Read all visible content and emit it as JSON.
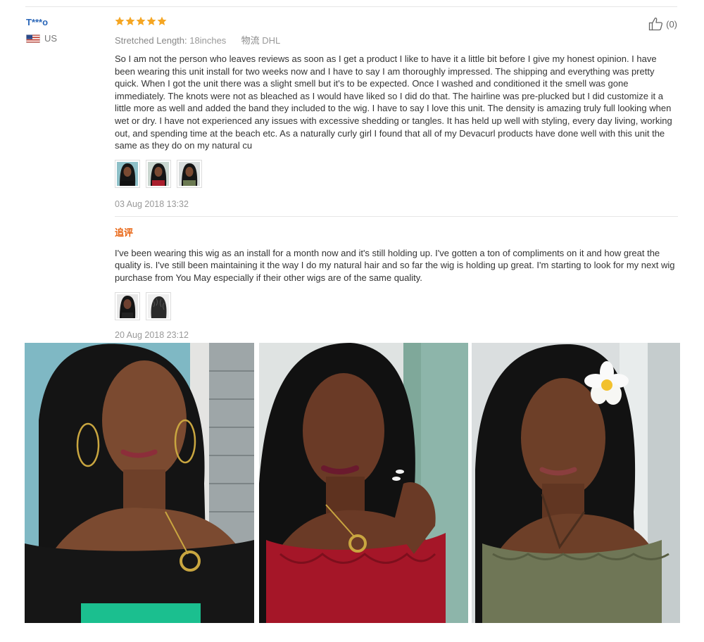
{
  "review": {
    "user": {
      "name": "T***o",
      "country": "US",
      "flag_icon": "us-flag-icon"
    },
    "rating": 5,
    "rating_color": "#f5a623",
    "attributes": {
      "length_label": "Stretched Length:",
      "length_value": "18inches",
      "shipping_label": "物流",
      "shipping_value": "DHL"
    },
    "helpful": {
      "icon": "thumbs-up-icon",
      "count": "(0)"
    },
    "text": "So I am not the person who leaves reviews as soon as I get a product I like to have it a little bit before I give my honest opinion. I have been wearing this unit install for two weeks now and I have to say I am thoroughly impressed. The shipping and everything was pretty quick. When I got the unit there was a slight smell but it's to be expected. Once I washed and conditioned it the smell was gone immediately. The knots were not as bleached as I would have liked so I did do that. The hairline was pre-plucked but I did customize it a little more as well and added the band they included to the wig. I have to say I love this unit. The density is amazing truly full looking when wet or dry. I have not experienced any issues with excessive shedding or tangles. It has held up well with styling, every day living, working out, and spending time at the beach etc. As a naturally curly girl I found that all of my Devacurl products have done well with this unit the same as they do on my natural cu",
    "date": "03 Aug 2018 13:32",
    "followup": {
      "label": "追评",
      "text": "I've been wearing this wig as an install for a month now and it's still holding up. I've gotten a ton of compliments on it and how great the quality is. I've still been maintaining it the way I do my natural hair and so far the wig is holding up great. I'm starting to look for my next wig purchase from You May especially if their other wigs are of the same quality.",
      "date": "20 Aug 2018 23:12"
    }
  }
}
